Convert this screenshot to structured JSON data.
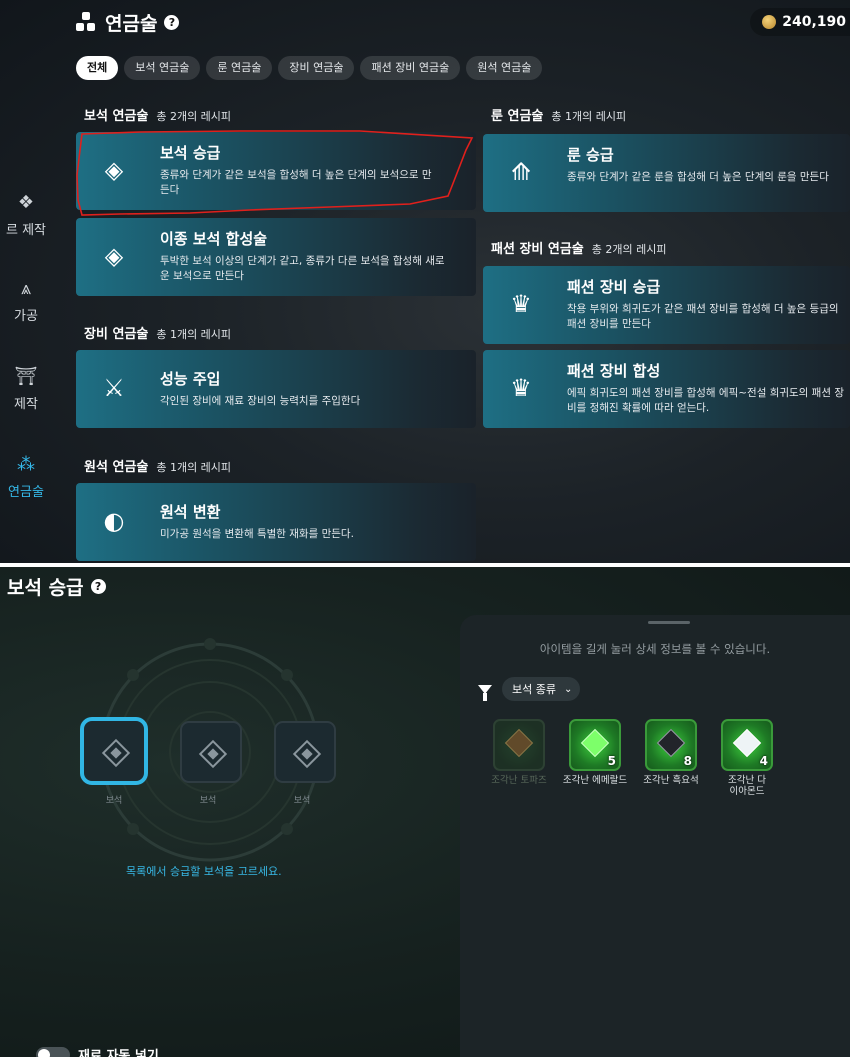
{
  "header": {
    "title": "연금술",
    "coins": "240,190"
  },
  "tabs": [
    "전체",
    "보석 연금술",
    "룬 연금술",
    "장비 연금술",
    "패션 장비 연금술",
    "원석 연금술"
  ],
  "sidebar": [
    {
      "label": "르 제작",
      "icon": "gem-cluster-icon"
    },
    {
      "label": "가공",
      "icon": "anvil-icon"
    },
    {
      "label": "제작",
      "icon": "workbench-icon"
    },
    {
      "label": "연금술",
      "icon": "alchemy-icon",
      "active": true
    }
  ],
  "sections": {
    "gem": {
      "title": "보석 연금술",
      "count": "총 2개의 레시피"
    },
    "equip": {
      "title": "장비 연금술",
      "count": "총 1개의 레시피"
    },
    "ore": {
      "title": "원석 연금술",
      "count": "총 1개의 레시피"
    },
    "rune": {
      "title": "룬 연금술",
      "count": "총 1개의 레시피"
    },
    "fashion": {
      "title": "패션 장비 연금술",
      "count": "총 2개의 레시피"
    }
  },
  "cards": {
    "gem_upgrade": {
      "title": "보석 승급",
      "desc": "종류와 단계가 같은 보석을 합성해 더 높은 단계의 보석으로 만든다"
    },
    "gem_synth": {
      "title": "이종 보석 합성술",
      "desc": "투박한 보석 이상의 단계가 같고, 종류가 다른 보석을 합성해 새로운 보석으로 만든다"
    },
    "infuse": {
      "title": "성능 주입",
      "desc": "각인된 장비에 재료 장비의 능력치를 주입한다"
    },
    "ore_convert": {
      "title": "원석 변환",
      "desc": "미가공 원석을 변환해 특별한 재화를 만든다."
    },
    "rune_upgrade": {
      "title": "룬 승급",
      "desc": "종류와 단계가 같은 룬을 합성해 더 높은 단계의 룬을 만든다"
    },
    "fashion_upgrade": {
      "title": "패션 장비 승급",
      "desc": "착용 부위와 희귀도가 같은 패션 장비를 합성해 더 높은 등급의 패션 장비를 만든다"
    },
    "fashion_synth": {
      "title": "패션 장비 합성",
      "desc": "에픽 희귀도의 패션 장비를 합성해 에픽~전설 희귀도의 패션 장비를 정해진 확률에 따라 얻는다."
    }
  },
  "detail": {
    "title": "보석 승급",
    "slots": [
      "보석",
      "보석",
      "보석"
    ],
    "hint": "목록에서 승급할 보석을 고르세요.",
    "info": "아이템을 길게 눌러 상세 정보를 볼 수 있습니다.",
    "filter": "보석 종류",
    "items": [
      {
        "name": "조각난 토파즈",
        "count": "",
        "color": "#c8a04a",
        "dim": true
      },
      {
        "name": "조각난 에메랄드",
        "count": "5",
        "color": "#7dff6a"
      },
      {
        "name": "조각난 흑요석",
        "count": "8",
        "color": "#2a2a30"
      },
      {
        "name": "조각난 다이아몬드",
        "count": "4",
        "color": "#eef4f6"
      }
    ],
    "toggle": "재료 자동 넣기"
  }
}
